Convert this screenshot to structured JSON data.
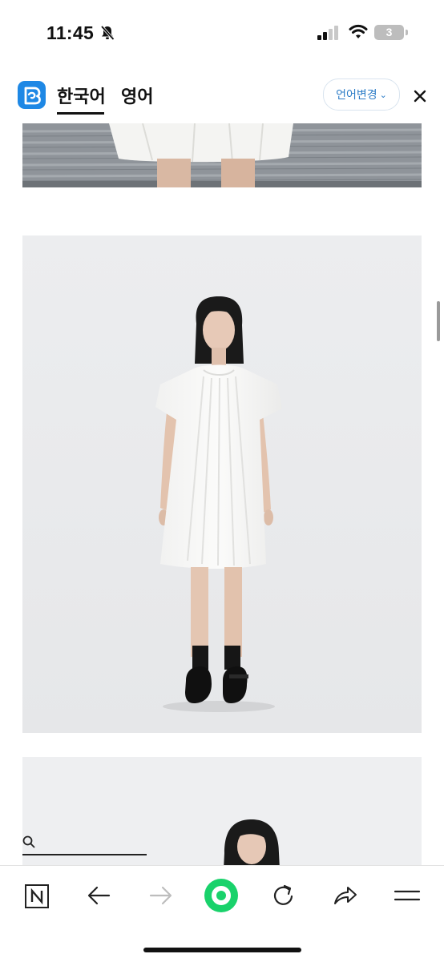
{
  "status_bar": {
    "time": "11:45",
    "battery_level": "3"
  },
  "translate_bar": {
    "tabs": [
      {
        "label": "한국어",
        "active": true
      },
      {
        "label": "영어",
        "active": false
      }
    ],
    "change_language_label": "언어변경"
  },
  "colors": {
    "accent_blue": "#2c7cc7",
    "app_logo": "#1e88e5",
    "green_button": "#19d26b"
  },
  "bottom_toolbar": {
    "items": [
      "n-home-icon",
      "back-arrow-icon",
      "forward-arrow-icon",
      "green-circle-button",
      "reload-icon",
      "share-icon",
      "menu-icon"
    ]
  }
}
